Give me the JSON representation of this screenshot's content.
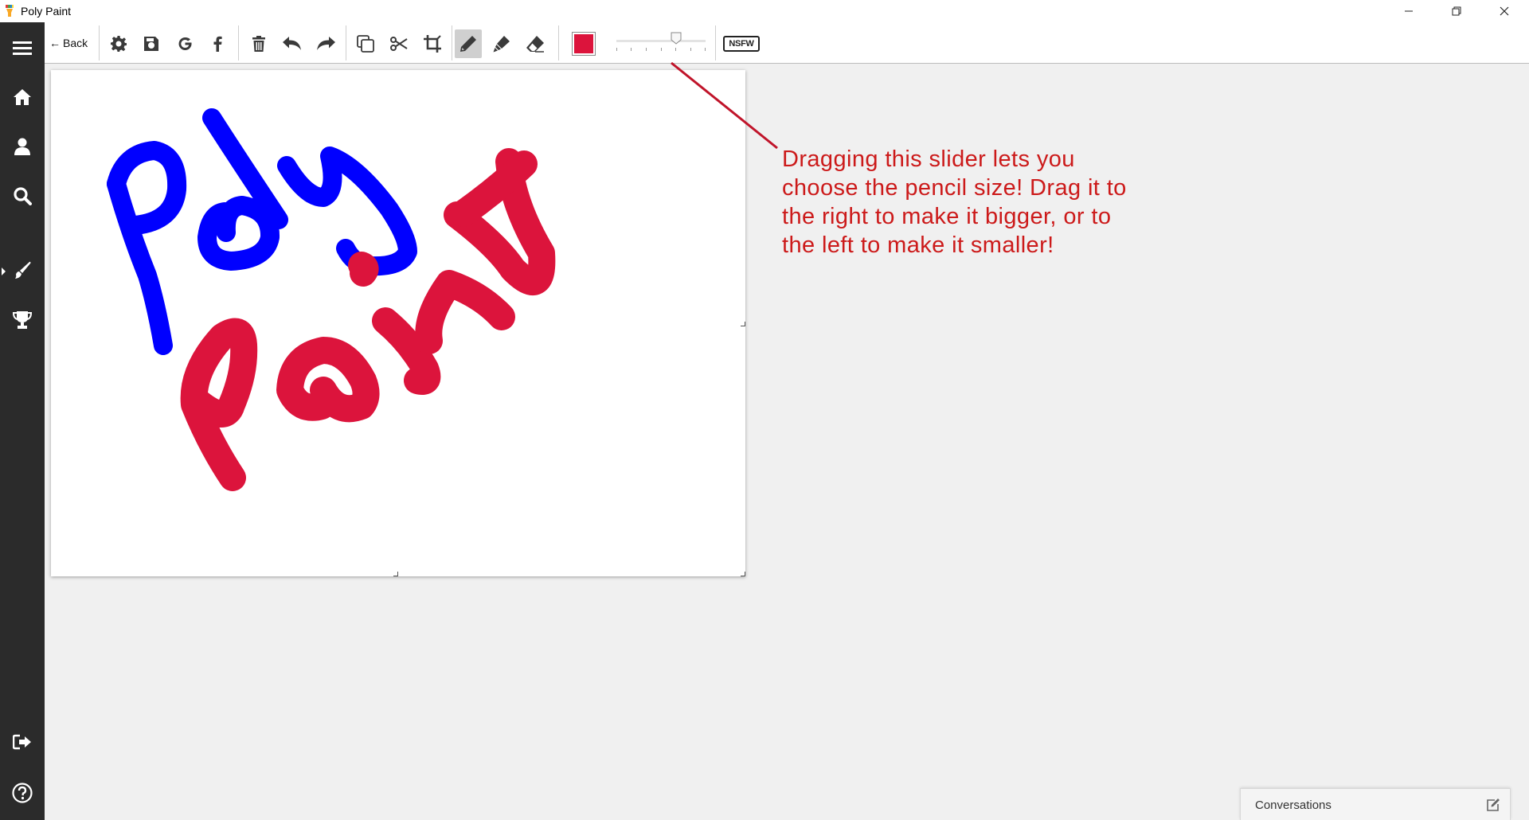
{
  "window": {
    "title": "Poly Paint",
    "controls": [
      "minimize",
      "restore",
      "close"
    ]
  },
  "sidebar": {
    "items": [
      {
        "name": "menu",
        "icon": "hamburger-icon"
      },
      {
        "name": "home",
        "icon": "home-icon"
      },
      {
        "name": "profile",
        "icon": "user-icon"
      },
      {
        "name": "search",
        "icon": "search-icon"
      },
      {
        "name": "draw",
        "icon": "paintbrush-icon",
        "active": true
      },
      {
        "name": "achievements",
        "icon": "trophy-icon"
      },
      {
        "name": "logout",
        "icon": "sign-out-icon"
      },
      {
        "name": "help",
        "icon": "help-icon"
      }
    ]
  },
  "toolbar": {
    "back_label": "Back",
    "back_arrow": "←",
    "tools": [
      "settings",
      "save",
      "google",
      "facebook",
      "delete",
      "undo",
      "redo",
      "duplicate",
      "cut",
      "crop",
      "pencil",
      "marker",
      "eraser"
    ],
    "selected_tool": "pencil",
    "current_color": "#dc143c",
    "size_level": 0.67,
    "nsfw_label": "NSFW"
  },
  "drawing": {
    "blue_color": "#0000ff",
    "red_color": "#dc143c",
    "blue_text": "Poly",
    "red_text": "Paint"
  },
  "annotation": {
    "text": "Dragging this slider lets you choose the pencil size! Drag it to the right to make it bigger, or to the left to make it smaller!",
    "color": "#cc1a1a"
  },
  "conversations": {
    "label": "Conversations"
  }
}
